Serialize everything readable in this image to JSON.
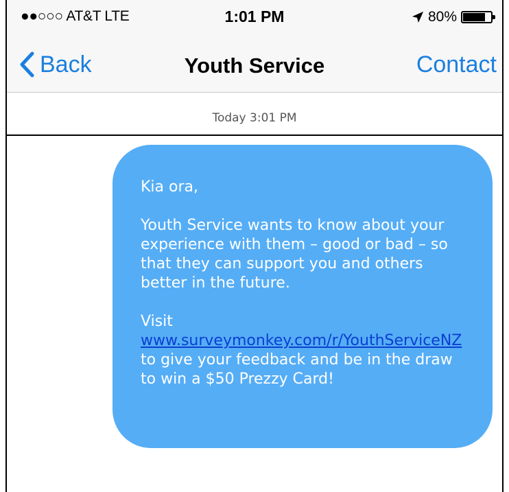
{
  "status_bar": {
    "signal": "●●○○○",
    "carrier": "AT&T",
    "network": "LTE",
    "time": "1:01 PM",
    "battery_text": "80%",
    "battery_level": 0.8
  },
  "nav": {
    "back_label": "Back",
    "title": "Youth Service",
    "contact_label": "Contact"
  },
  "conversation": {
    "timestamp": "Today 3:01 PM",
    "message": {
      "greeting": "Kia ora,",
      "body": "Youth Service wants to know about your experience with them – good or bad – so that they can support you and others better in the future.",
      "visit_label": "Visit",
      "link_text": "www.surveymonkey.com/r/YouthServiceNZ",
      "after_link": " to give your feedback and be in the draw to win a $50 Prezzy Card!"
    }
  },
  "colors": {
    "accent": "#1a7fe0",
    "bubble": "#55adf6",
    "link": "#0a3fd0"
  }
}
